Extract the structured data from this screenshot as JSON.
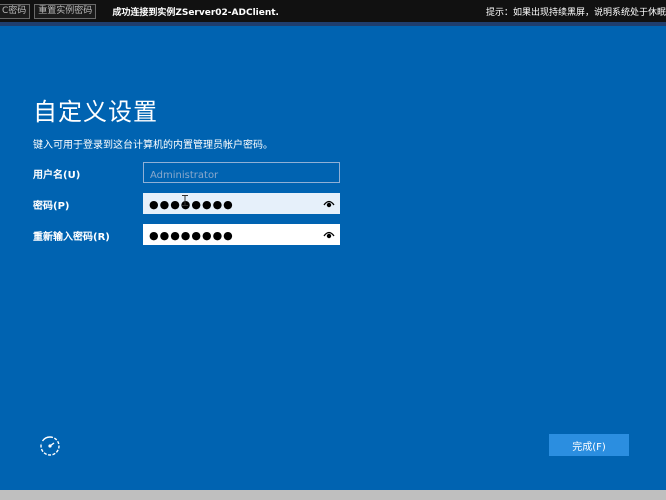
{
  "toolbar": {
    "button_1": "C密码",
    "button_2": "重置实例密码",
    "status": "成功连接到实例ZServer02-ADClient.",
    "hint": "提示：如果出现持续黑屏，说明系统处于休眠"
  },
  "setup": {
    "title": "自定义设置",
    "subtitle": "键入可用于登录到这台计算机的内置管理员帐户密码。",
    "username_label": "用户名(U)",
    "username_placeholder": "Administrator",
    "password_label": "密码(P)",
    "password_value": "●●●●●●●●",
    "confirm_label": "重新输入密码(R)",
    "confirm_value": "●●●●●●●●",
    "finish_label": "完成(F)"
  },
  "icons": {
    "eye": "eye-icon",
    "accessibility": "ease-of-access-icon",
    "cursor": "text-cursor-icon"
  },
  "colors": {
    "background": "#0063b1",
    "topbar": "#111111",
    "finish_button": "#2b8ee0"
  }
}
